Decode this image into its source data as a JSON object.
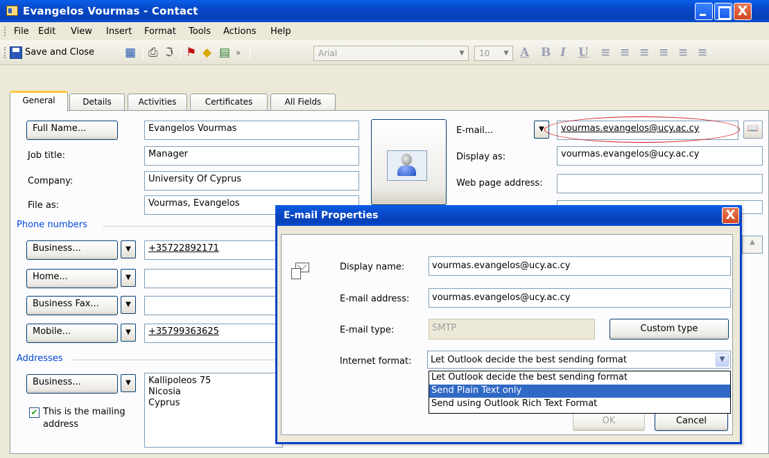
{
  "window": {
    "title": "Evangelos Vourmas - Contact",
    "close_glyph": "X"
  },
  "menu": [
    "File",
    "Edit",
    "View",
    "Insert",
    "Format",
    "Tools",
    "Actions",
    "Help"
  ],
  "toolbar": {
    "save_close": "Save and Close",
    "font": "Arial",
    "size": "10"
  },
  "tabs": [
    "General",
    "Details",
    "Activities",
    "Certificates",
    "All Fields"
  ],
  "general": {
    "full_name_btn": "Full Name...",
    "full_name": "Evangelos Vourmas",
    "job_title_label": "Job title:",
    "job_title": "Manager",
    "company_label": "Company:",
    "company": "University Of Cyprus",
    "file_as_label": "File as:",
    "file_as": "Vourmas, Evangelos",
    "phone_header": "Phone numbers",
    "phones": [
      {
        "label": "Business...",
        "value": "+35722892171"
      },
      {
        "label": "Home...",
        "value": ""
      },
      {
        "label": "Business Fax...",
        "value": ""
      },
      {
        "label": "Mobile...",
        "value": "+35799363625"
      }
    ],
    "addresses_header": "Addresses",
    "address_type": "Business...",
    "address_lines": [
      "Kallipoleos 75",
      "Nicosia",
      "Cyprus"
    ],
    "mailing_check": "✔",
    "mailing_label_1": "This is the mailing",
    "mailing_label_2": "address",
    "email_btn": "E-mail...",
    "email": "vourmas.evangelos@ucy.ac.cy",
    "display_as_label": "Display as:",
    "display_as": "vourmas.evangelos@ucy.ac.cy",
    "web_label": "Web page address:",
    "web": ""
  },
  "dialog": {
    "title": "E-mail Properties",
    "display_name_label": "Display name:",
    "display_name": "vourmas.evangelos@ucy.ac.cy",
    "email_address_label": "E-mail address:",
    "email_address": "vourmas.evangelos@ucy.ac.cy",
    "email_type_label": "E-mail type:",
    "email_type": "SMTP",
    "custom_type_btn": "Custom type",
    "internet_format_label": "Internet format:",
    "internet_format": "Let Outlook decide the best sending format",
    "format_options": [
      "Let Outlook decide the best sending format",
      "Send Plain Text only",
      "Send using Outlook Rich Text Format"
    ],
    "ok": "OK",
    "cancel": "Cancel"
  },
  "colors": {
    "title_blue": "#0848C8",
    "section_blue": "#0046D5",
    "highlight": "#316AC5",
    "annotation_red": "#D01818"
  }
}
